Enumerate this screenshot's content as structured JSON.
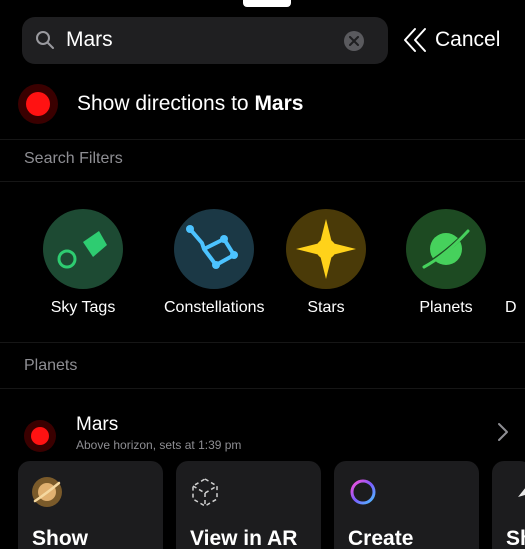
{
  "search": {
    "query": "Mars",
    "cancel_label": "Cancel"
  },
  "directions": {
    "prefix": "Show directions to ",
    "target": "Mars"
  },
  "filters": {
    "header": "Search Filters",
    "items": [
      {
        "label": "Sky Tags",
        "icon": "sky-tag-icon",
        "color": "#1d4a33"
      },
      {
        "label": "Constellations",
        "icon": "constellation-icon",
        "color": "#1b3845"
      },
      {
        "label": "Stars",
        "icon": "star-icon",
        "color": "#4a3a08"
      },
      {
        "label": "Planets",
        "icon": "planet-icon",
        "color": "#1d4a22"
      },
      {
        "label": "D",
        "icon": "deep-sky-icon",
        "color": "#2a2a2a"
      }
    ]
  },
  "planets": {
    "header": "Planets",
    "items": [
      {
        "name": "Mars",
        "subtitle": "Above horizon, sets at 1:39 pm"
      }
    ]
  },
  "actions": {
    "items": [
      {
        "label": "Show",
        "icon": "planet-sphere-icon"
      },
      {
        "label": "View in AR",
        "icon": "ar-cube-icon"
      },
      {
        "label": "Create",
        "icon": "create-ring-icon"
      },
      {
        "label": "Sh",
        "icon": "share-icon"
      }
    ]
  },
  "colors": {
    "accent_red": "#ff1212",
    "sky_tag_green": "#2ecc71",
    "constellation_blue": "#4cc3ff",
    "star_yellow": "#ffd21a",
    "planet_green": "#46d15c"
  }
}
